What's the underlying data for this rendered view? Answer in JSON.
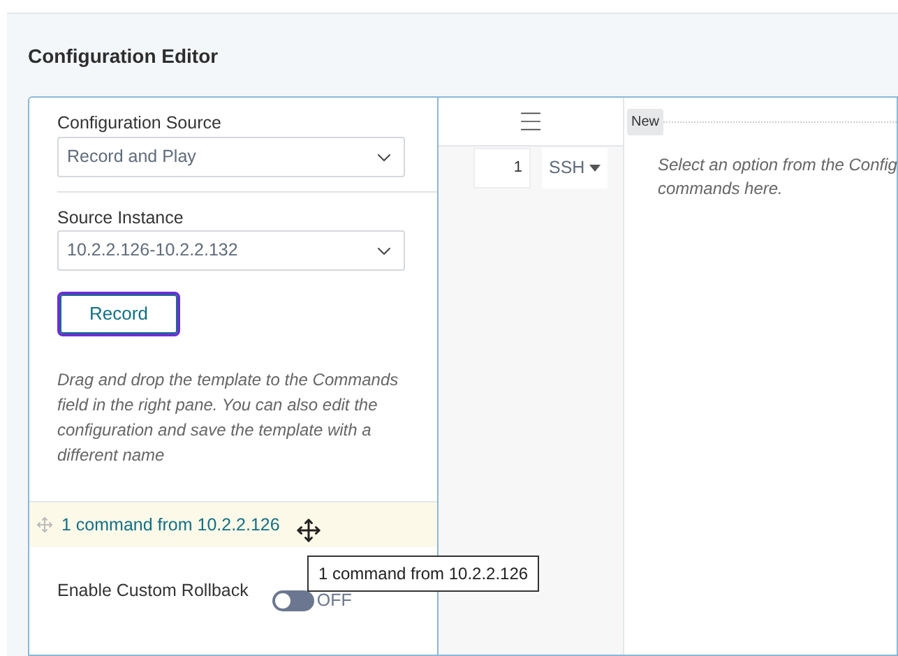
{
  "title": "Configuration Editor",
  "left": {
    "source_label": "Configuration Source",
    "source_value": "Record and Play",
    "instance_label": "Source Instance",
    "instance_value": "10.2.2.126-10.2.2.132",
    "record_button": {
      "label": "Record",
      "focused": true
    },
    "hint": "Drag and drop the template to the Commands field in the right pane. You can also edit the configuration and save the template with a different name",
    "command_item": {
      "label": "1 command from 10.2.2.126",
      "tooltip": "1 command from 10.2.2.126"
    },
    "rollback": {
      "label": "Enable Custom Rollback",
      "on": false,
      "state_text": "OFF"
    }
  },
  "middle": {
    "order_value": "1",
    "protocol": "SSH"
  },
  "right": {
    "badge": "New",
    "message_lines": [
      "Select an option from the Config",
      "commands here."
    ]
  }
}
